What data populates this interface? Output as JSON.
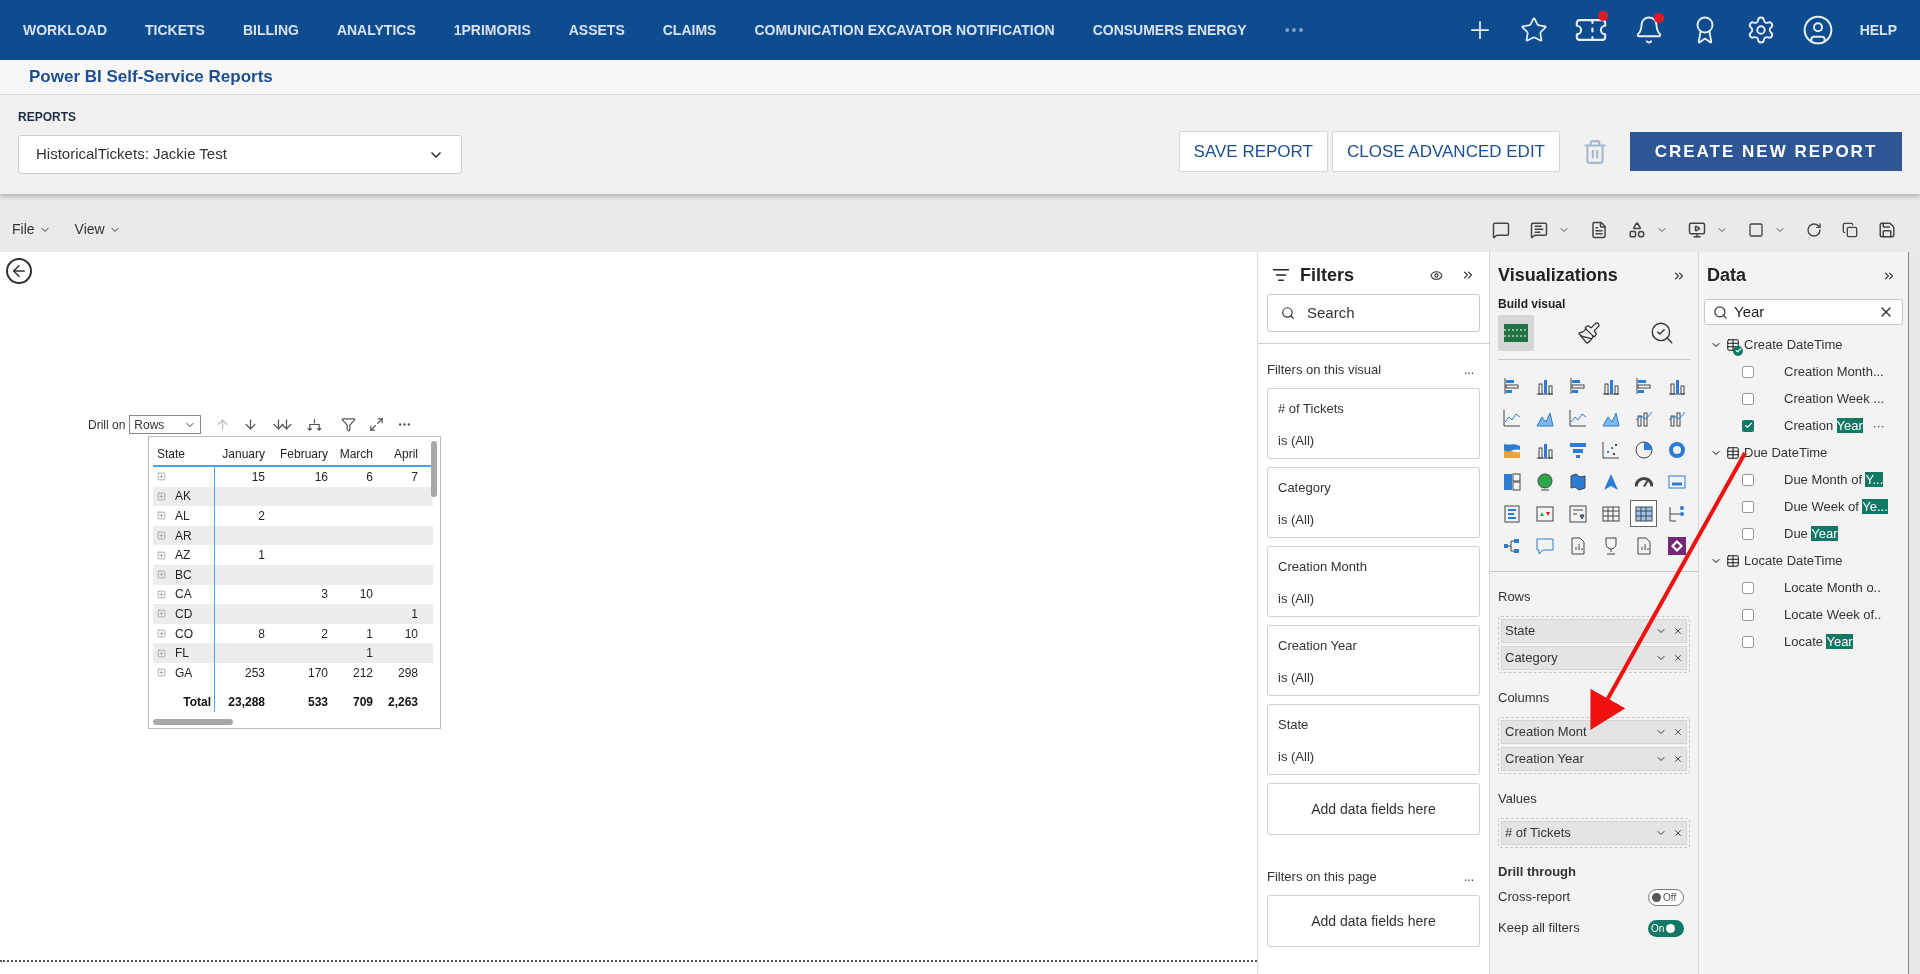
{
  "nav": {
    "items": [
      "WORKLOAD",
      "TICKETS",
      "BILLING",
      "ANALYTICS",
      "1PRIMORIS",
      "ASSETS",
      "CLAIMS",
      "COMUNICATION EXCAVATOR NOTIFICATION",
      "CONSUMERS ENERGY"
    ],
    "more": "•••",
    "help": "HELP"
  },
  "page_title": "Power BI Self-Service Reports",
  "reports": {
    "label": "REPORTS",
    "value": "HistoricalTickets: Jackie Test"
  },
  "actions": [
    "SAVE REPORT",
    "CLOSE ADVANCED EDIT"
  ],
  "create_button": "CREATE NEW REPORT",
  "menu": [
    "File",
    "View"
  ],
  "visual": {
    "drill_label": "Drill on",
    "drill_value": "Rows",
    "columns": [
      "State",
      "January",
      "February",
      "March",
      "April"
    ],
    "rows": [
      [
        "",
        "15",
        "16",
        "6",
        "7"
      ],
      [
        "AK",
        "",
        "",
        "",
        ""
      ],
      [
        "AL",
        "2",
        "",
        "",
        ""
      ],
      [
        "AR",
        "",
        "",
        "",
        ""
      ],
      [
        "AZ",
        "1",
        "",
        "",
        ""
      ],
      [
        "BC",
        "",
        "",
        "",
        ""
      ],
      [
        "CA",
        "",
        "3",
        "10",
        ""
      ],
      [
        "CD",
        "",
        "",
        "",
        "1"
      ],
      [
        "CO",
        "8",
        "2",
        "1",
        "10"
      ],
      [
        "FL",
        "",
        "",
        "1",
        ""
      ],
      [
        "GA",
        "253",
        "170",
        "212",
        "298"
      ]
    ],
    "total": [
      "Total",
      "23,288",
      "533",
      "709",
      "2,263"
    ]
  },
  "filters": {
    "title": "Filters",
    "search_placeholder": "Search",
    "visual_section": "Filters on this visual",
    "more": "...",
    "cards": [
      {
        "name": "# of Tickets",
        "value": "is (All)"
      },
      {
        "name": "Category",
        "value": "is (All)"
      },
      {
        "name": "Creation Month",
        "value": "is (All)"
      },
      {
        "name": "Creation Year",
        "value": "is (All)"
      },
      {
        "name": "State",
        "value": "is (All)"
      }
    ],
    "add_fields": "Add data fields here",
    "page_section": "Filters on this page",
    "page_more": "...",
    "page_add_fields": "Add data fields here"
  },
  "visualizations": {
    "title": "Visualizations",
    "subtitle": "Build visual",
    "tabs": [
      {
        "selected": true
      },
      {
        "selected": false
      },
      {
        "selected": false
      }
    ],
    "gallery": [
      {
        "selected": false
      },
      {
        "selected": false
      },
      {
        "selected": false
      },
      {
        "selected": false
      },
      {
        "selected": false
      },
      {
        "selected": false
      },
      {
        "selected": false
      },
      {
        "selected": false
      },
      {
        "selected": false
      },
      {
        "selected": false
      },
      {
        "selected": false
      },
      {
        "selected": false
      },
      {
        "selected": false
      },
      {
        "selected": false
      },
      {
        "selected": false
      },
      {
        "selected": false
      },
      {
        "selected": false
      },
      {
        "selected": false
      },
      {
        "selected": false
      },
      {
        "selected": false
      },
      {
        "selected": false
      },
      {
        "selected": false
      },
      {
        "selected": false
      },
      {
        "selected": false
      },
      {
        "selected": false
      },
      {
        "selected": false
      },
      {
        "selected": false
      },
      {
        "selected": false
      },
      {
        "selected": true
      },
      {
        "selected": false
      },
      {
        "selected": false
      },
      {
        "selected": false
      },
      {
        "selected": false
      },
      {
        "selected": false
      },
      {
        "selected": false
      },
      {
        "selected": false
      }
    ],
    "wells": [
      {
        "label": "Rows",
        "fields": [
          "State",
          "Category"
        ]
      },
      {
        "label": "Columns",
        "fields": [
          "Creation Mont",
          "Creation Year"
        ]
      },
      {
        "label": "Values",
        "fields": [
          "# of Tickets"
        ]
      }
    ],
    "drill_title": "Drill through",
    "toggles": [
      {
        "label": "Cross-report",
        "on": false,
        "state": "Off"
      },
      {
        "label": "Keep all filters",
        "on": true,
        "state": "On"
      }
    ]
  },
  "data": {
    "title": "Data",
    "search_value": "Year",
    "groups": [
      {
        "name": "Create DateTime",
        "expanded": true,
        "in_use": true,
        "children": [
          {
            "label": "Creation Month...",
            "checked": false
          },
          {
            "label": "Creation Week ...",
            "checked": false
          },
          {
            "label": "Creation ",
            "match": "Year",
            "checked": true,
            "more": "···"
          }
        ]
      },
      {
        "name": "Due DateTime",
        "expanded": true,
        "in_use": false,
        "children": [
          {
            "label": "Due Month of ",
            "match": "Y...",
            "checked": false
          },
          {
            "label": "Due Week of ",
            "match": "Ye...",
            "checked": false
          },
          {
            "label": "Due ",
            "match": "Year",
            "checked": false
          }
        ]
      },
      {
        "name": "Locate DateTime",
        "expanded": true,
        "in_use": false,
        "children": [
          {
            "label": "Locate Month o..",
            "checked": false
          },
          {
            "label": "Locate Week of..",
            "checked": false
          },
          {
            "label": "Locate ",
            "match": "Year",
            "checked": false
          }
        ]
      }
    ]
  }
}
